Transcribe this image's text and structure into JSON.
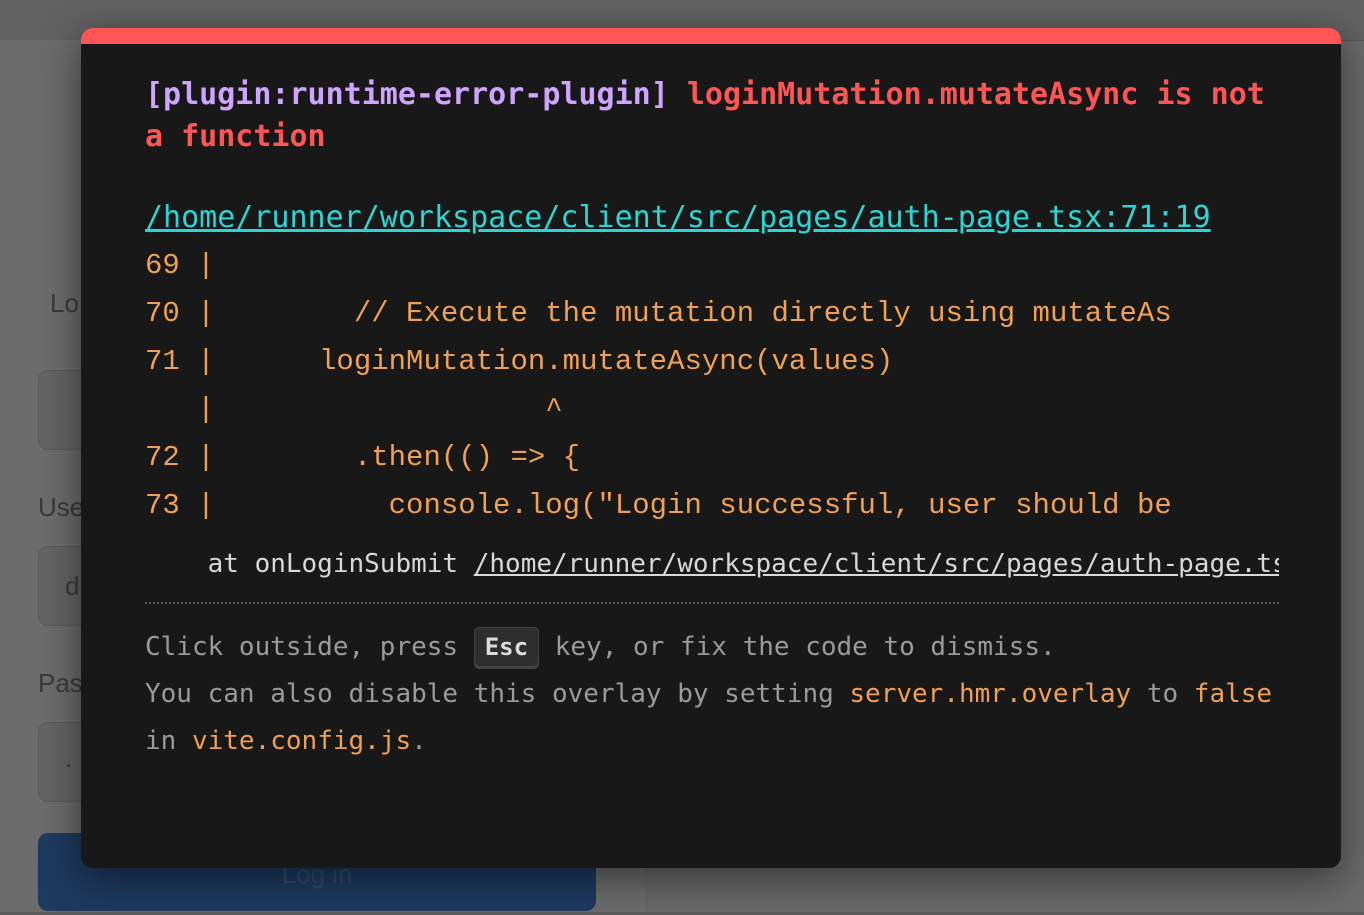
{
  "background": {
    "partial_texts": [
      "Lo",
      "Use",
      "d",
      "Pas",
      "."
    ],
    "login_button_label": "Log in"
  },
  "overlay": {
    "plugin": "[plugin:runtime-error-plugin]",
    "message": "loginMutation.mutateAsync is not a function",
    "file": "/home/runner/workspace/client/src/pages/auth-page.tsx:71:19",
    "frame_lines": [
      "69 |",
      "70 |        // Execute the mutation directly using mutateAs",
      "71 |      loginMutation.mutateAsync(values)",
      "   |                   ^",
      "72 |        .then(() => {",
      "73 |          console.log(\"Login successful, user should be"
    ],
    "stack_prefix": "    at onLoginSubmit ",
    "stack_location": "/home/runner/workspace/client/src/pages/auth-page.ts",
    "tip": {
      "line1_before": "Click outside, press ",
      "esc_key": "Esc",
      "line1_after": " key, or fix the code to dismiss.",
      "line2_before": "You can also disable this overlay by setting ",
      "setting": "server.hmr.overlay",
      "to_word": " to ",
      "false_word": "false",
      "line3_before": "in ",
      "config_file": "vite.config.js",
      "line3_after": "."
    }
  },
  "colors": {
    "accent": "#ff5555",
    "plugin": "#cfa4ff",
    "link": "#2dd4d4",
    "code": "#f0a055"
  }
}
